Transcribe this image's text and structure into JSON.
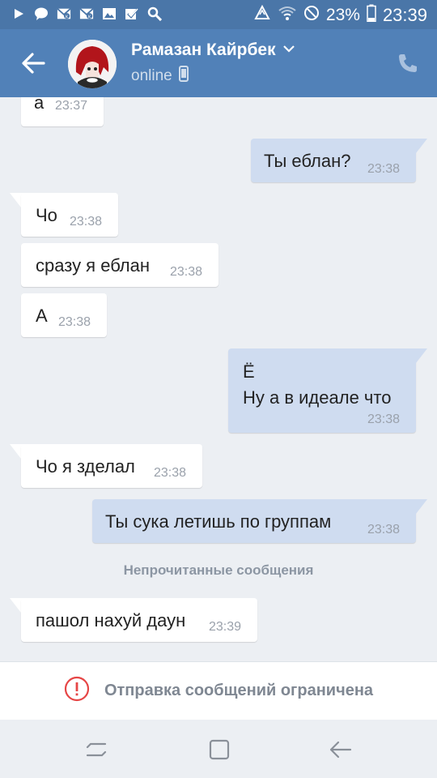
{
  "status_bar": {
    "battery": "23%",
    "time": "23:39"
  },
  "header": {
    "contact_name": "Рамазан Кайрбек",
    "status": "online"
  },
  "messages": [
    {
      "direction": "in",
      "text": "а",
      "time": "23:37"
    },
    {
      "direction": "out",
      "text": "Ты еблан?",
      "time": "23:38"
    },
    {
      "direction": "in",
      "text": "Чо",
      "time": "23:38"
    },
    {
      "direction": "in",
      "text": "сразу я еблан",
      "time": "23:38"
    },
    {
      "direction": "in",
      "text": "А",
      "time": "23:38"
    },
    {
      "direction": "out",
      "text_line1": "Ё",
      "text_line2": "Ну а в идеале что",
      "time": "23:38"
    },
    {
      "direction": "in",
      "text": "Чо я зделал",
      "time": "23:38"
    },
    {
      "direction": "out",
      "text": "Ты сука летишь по группам",
      "time": "23:38"
    },
    {
      "direction": "in",
      "text": "пашол нахуй даун",
      "time": "23:39"
    }
  ],
  "unread_divider": "Непрочитанные сообщения",
  "bottom_notice": "Отправка сообщений ограничена",
  "colors": {
    "status_bar": "#4a76a8",
    "app_bar": "#5181b8",
    "incoming_bubble": "#ffffff",
    "outgoing_bubble": "#cfdcf0",
    "warning": "#e64646"
  },
  "icons": [
    "play-icon",
    "chat-icon",
    "mail-icon",
    "mail-icon",
    "image-icon",
    "check-icon",
    "search-icon",
    "recycle-icon",
    "wifi-icon",
    "no-sound-icon",
    "battery-icon",
    "back-arrow-icon",
    "chevron-down-icon",
    "mobile-icon",
    "phone-icon",
    "warning-icon",
    "recent-apps-icon",
    "home-icon",
    "back-icon"
  ]
}
